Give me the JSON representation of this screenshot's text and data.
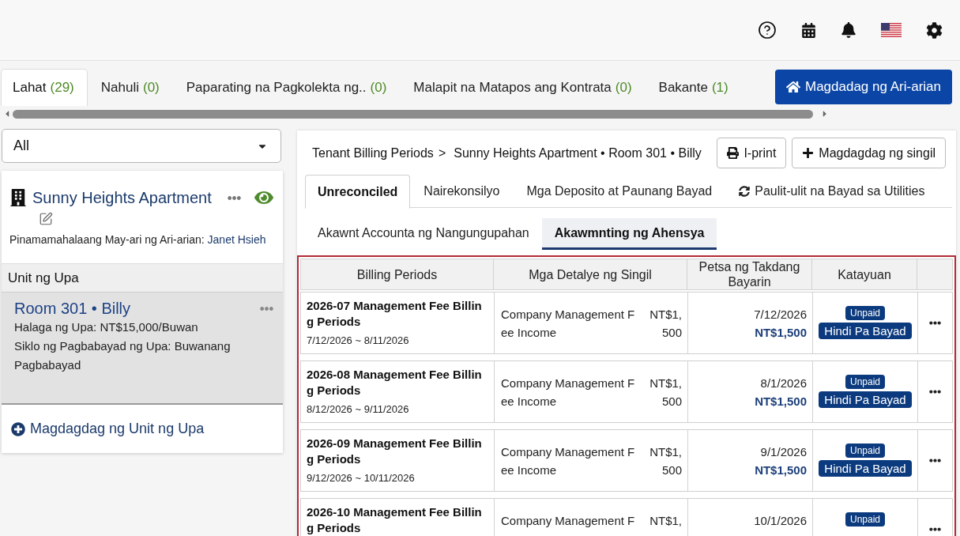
{
  "property_tabs": [
    {
      "label": "Lahat",
      "count": "(29)",
      "selected": true
    },
    {
      "label": "Nahuli",
      "count": "(0)",
      "selected": false
    },
    {
      "label": "Paparating na Pagkolekta ng..",
      "count": "(0)",
      "selected": false
    },
    {
      "label": "Malapit na Matapos ang Kontrata",
      "count": "(0)",
      "selected": false
    },
    {
      "label": "Bakante",
      "count": "(1)",
      "selected": false
    }
  ],
  "add_property_button": {
    "label": "Magdadag ng Ari-arian"
  },
  "filter_select": {
    "value": "All"
  },
  "property": {
    "name": "Sunny Heights Apartment",
    "owner_label": "Pinamamahalaang May-ari ng Ari-arian:",
    "owner_name": "Janet Hsieh",
    "units_heading": "Unit ng Upa",
    "units": [
      {
        "title": "Room 301 • Billy",
        "rent": "Halaga ng Upa: NT$15,000/Buwan",
        "cycle": "Siklo ng Pagbabayad ng Upa: Buwanang Pagbabayad",
        "selected": true
      }
    ],
    "add_unit": "Magdagdag ng Unit ng Upa"
  },
  "billing": {
    "breadcrumb": {
      "root": "Tenant Billing Periods",
      "separator": ">",
      "current": "Sunny Heights Apartment • Room 301 • Billy"
    },
    "actions": [
      {
        "kind": "print",
        "label": "I-print"
      },
      {
        "kind": "add",
        "label": "Magdagdag ng singil"
      }
    ],
    "tabs": [
      {
        "kind": "plain",
        "label": "Unreconciled",
        "selected": true
      },
      {
        "kind": "plain",
        "label": "Nairekonsilyo",
        "selected": false
      },
      {
        "kind": "plain",
        "label": "Mga Deposito at Paunang Bayad",
        "selected": false
      },
      {
        "kind": "recurring",
        "label": "Paulit-ulit na Bayad sa Utilities",
        "selected": false
      }
    ],
    "sub_tabs": [
      {
        "label": "Akawnt Accounta ng Nangungupahan",
        "selected": false
      },
      {
        "label": "Akawmnting ng Ahensya",
        "selected": true
      }
    ],
    "table": {
      "columns": [
        "Billing Periods",
        "Mga Detalye ng Singil",
        "Petsa ng Takdang Bayarin",
        "Katayuan"
      ],
      "rows": [
        {
          "period": "2026-07 Management Fee Billing Periods",
          "range": "7/12/2026 ~ 8/11/2026",
          "details": "Company Management Fee Income",
          "amount": "NT$1,500",
          "due_date": "7/12/2026",
          "due_amount": "NT$1,500",
          "status": "Unpaid",
          "status_label": "Hindi Pa Bayad"
        },
        {
          "period": "2026-08 Management Fee Billing Periods",
          "range": "8/12/2026 ~ 9/11/2026",
          "details": "Company Management Fee Income",
          "amount": "NT$1,500",
          "due_date": "8/1/2026",
          "due_amount": "NT$1,500",
          "status": "Unpaid",
          "status_label": "Hindi Pa Bayad"
        },
        {
          "period": "2026-09 Management Fee Billing Periods",
          "range": "9/12/2026 ~ 10/11/2026",
          "details": "Company Management Fee Income",
          "amount": "NT$1,500",
          "due_date": "9/1/2026",
          "due_amount": "NT$1,500",
          "status": "Unpaid",
          "status_label": "Hindi Pa Bayad"
        },
        {
          "period": "2026-10 Management Fee Billing Periods",
          "details": "Company Management F",
          "amount": "NT$1,",
          "due_date": "10/1/2026",
          "status": "Unpaid"
        }
      ]
    }
  }
}
